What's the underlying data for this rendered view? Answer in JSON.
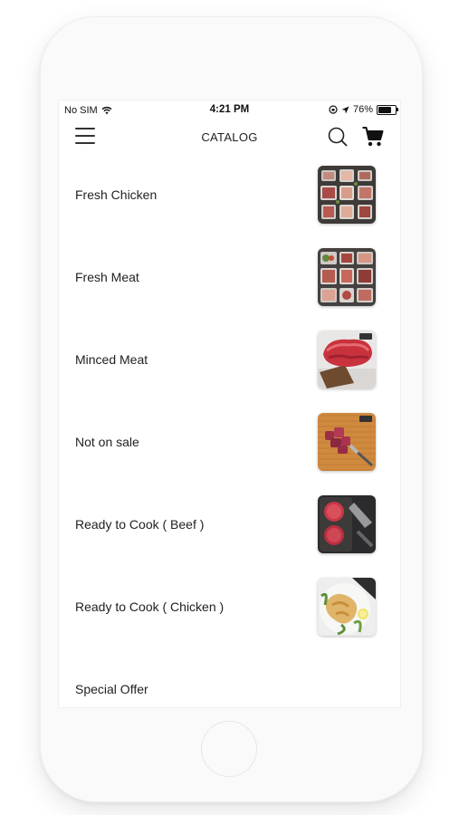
{
  "status_bar": {
    "carrier": "No SIM",
    "time": "4:21 PM",
    "battery_percent": "76%",
    "battery_level": 0.76,
    "icons": [
      "wifi-icon",
      "orientation-lock-icon",
      "location-icon",
      "battery-icon"
    ]
  },
  "header": {
    "title": "CATALOG",
    "menu_icon": "hamburger-menu-icon",
    "search_icon": "search-icon",
    "cart_icon": "cart-icon"
  },
  "catalog": {
    "items": [
      {
        "label": "Fresh Chicken",
        "image": "meat-platter-thumbnail"
      },
      {
        "label": "Fresh Meat",
        "image": "meat-cuts-thumbnail"
      },
      {
        "label": "Minced Meat",
        "image": "minced-meat-thumbnail"
      },
      {
        "label": "Not on sale",
        "image": "cubed-meat-thumbnail"
      },
      {
        "label": "Ready to Cook ( Beef )",
        "image": "beef-patties-thumbnail"
      },
      {
        "label": "Ready to Cook ( Chicken )",
        "image": "chicken-dish-thumbnail"
      },
      {
        "label": "Special Offer"
      }
    ]
  }
}
